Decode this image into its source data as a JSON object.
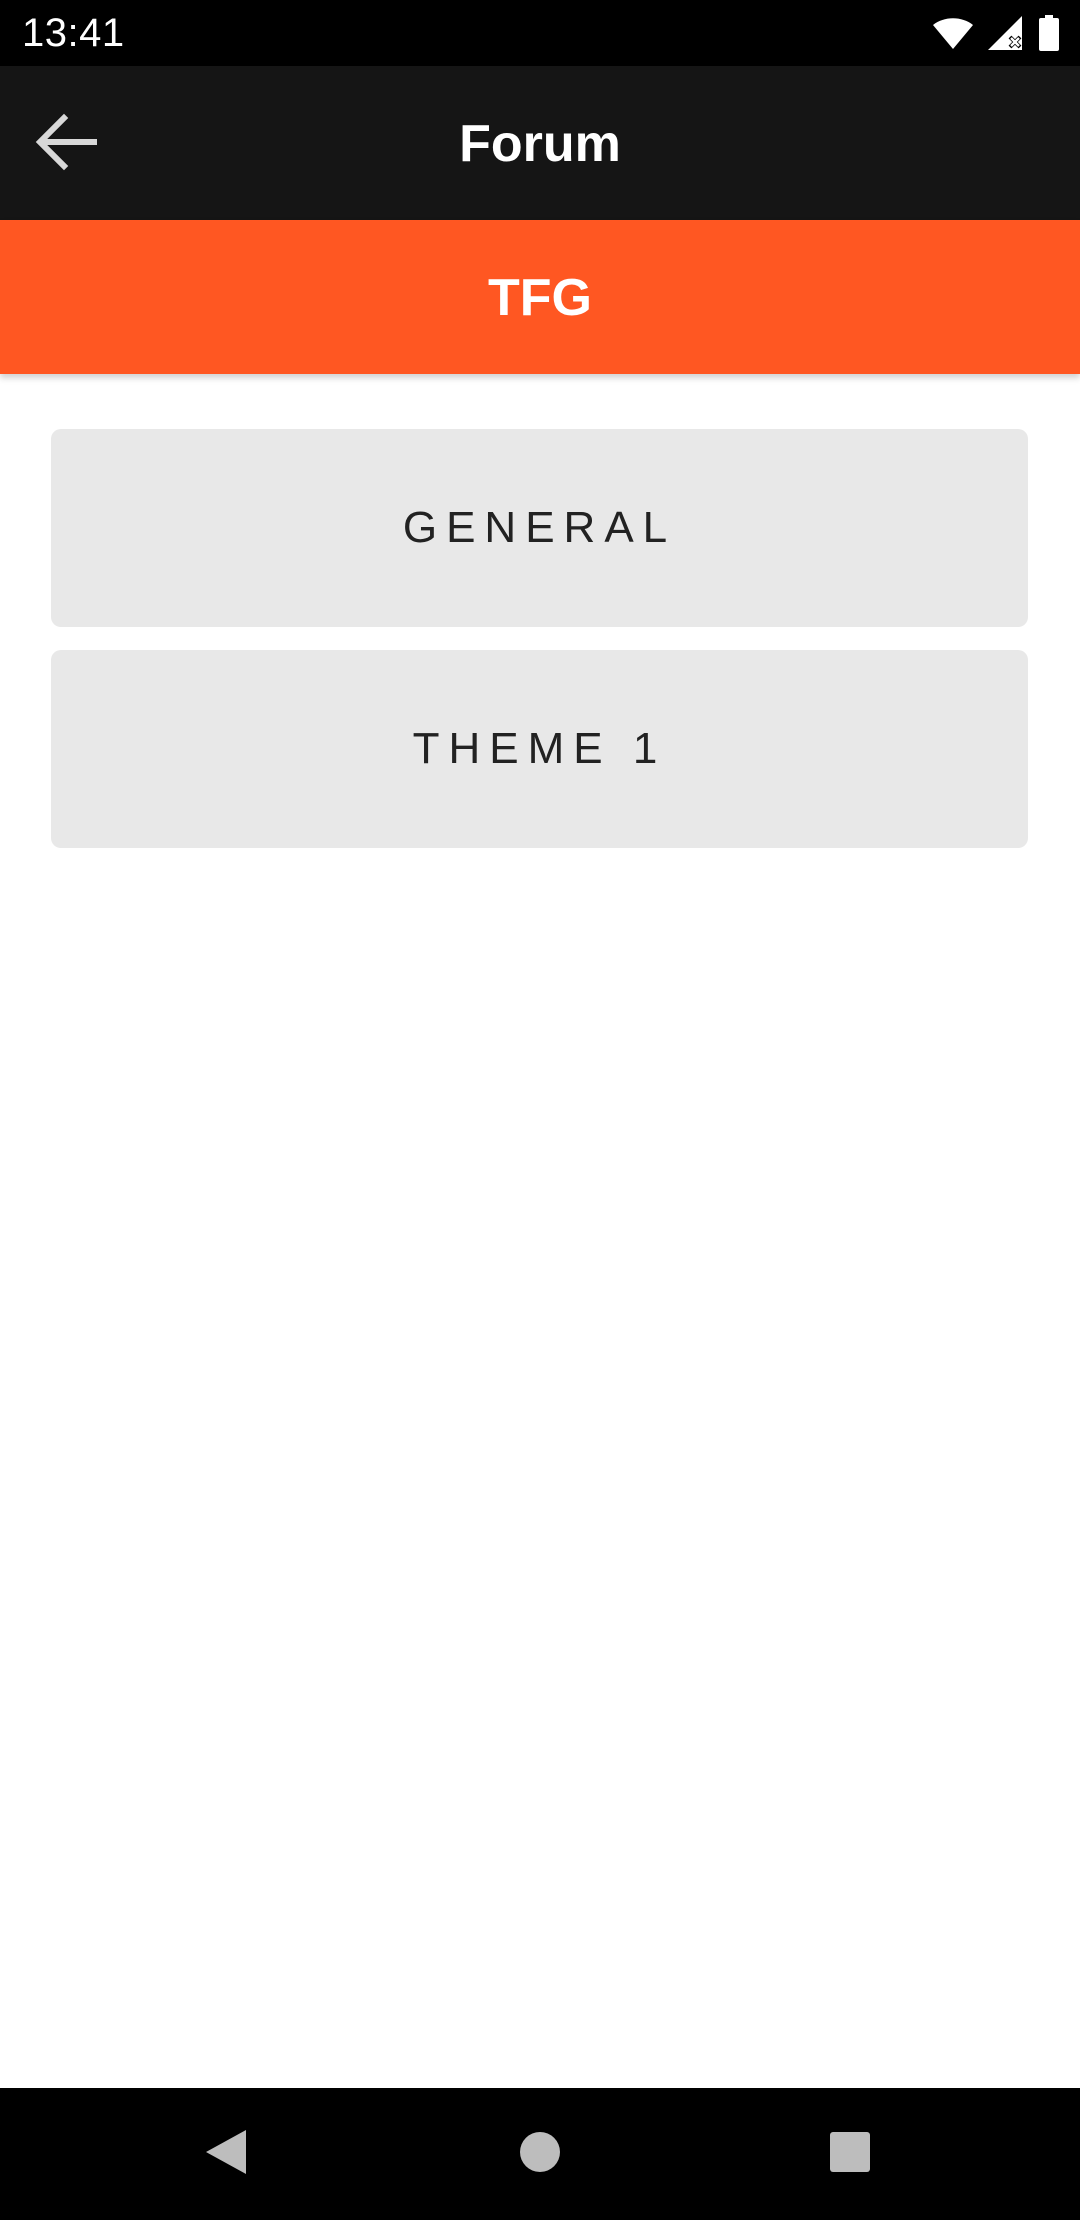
{
  "status_bar": {
    "time": "13:41",
    "icons": [
      "wifi-icon",
      "cell-signal-icon",
      "battery-icon"
    ]
  },
  "toolbar": {
    "title": "Forum",
    "back_icon": "arrow-left-icon"
  },
  "banner": {
    "title": "TFG",
    "color": "#ff5722"
  },
  "forums": [
    {
      "label": "GENERAL"
    },
    {
      "label": "THEME 1"
    }
  ],
  "nav_bar": {
    "icons": [
      "nav-back-icon",
      "nav-home-icon",
      "nav-recents-icon"
    ]
  },
  "colors": {
    "toolbar_bg": "#151515",
    "accent": "#ff5722",
    "button_bg": "#e8e8e8"
  }
}
